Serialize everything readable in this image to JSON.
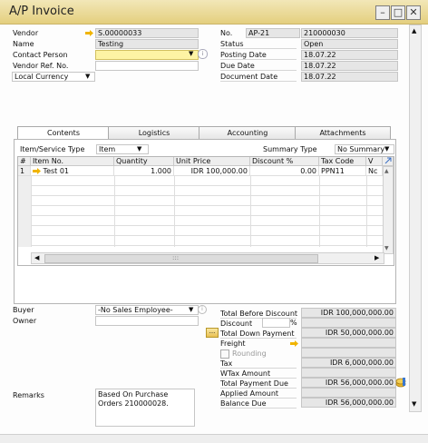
{
  "window": {
    "title": "A/P Invoice"
  },
  "header_left": {
    "vendor": {
      "label": "Vendor",
      "value": "S.00000033"
    },
    "name": {
      "label": "Name",
      "value": "Testing"
    },
    "contact_person": {
      "label": "Contact Person",
      "value": ""
    },
    "vendor_ref": {
      "label": "Vendor Ref. No.",
      "value": ""
    },
    "currency": {
      "value": "Local Currency"
    }
  },
  "header_right": {
    "no": {
      "label": "No.",
      "series": "AP-21",
      "value": "210000030"
    },
    "status": {
      "label": "Status",
      "value": "Open"
    },
    "posting_date": {
      "label": "Posting Date",
      "value": "18.07.22"
    },
    "due_date": {
      "label": "Due Date",
      "value": "18.07.22"
    },
    "document_date": {
      "label": "Document Date",
      "value": "18.07.22"
    }
  },
  "tabs": [
    "Contents",
    "Logistics",
    "Accounting",
    "Attachments"
  ],
  "contents": {
    "item_type_label": "Item/Service Type",
    "item_type_value": "Item",
    "summary_type_label": "Summary Type",
    "summary_type_value": "No Summary",
    "columns": [
      "#",
      "Item No.",
      "Quantity",
      "Unit Price",
      "Discount %",
      "Tax Code",
      "V"
    ],
    "rows": [
      {
        "num": "1",
        "item": "Test 01",
        "qty": "1.000",
        "price": "IDR 100,000.00",
        "discount": "0.00",
        "tax": "PPN11",
        "v": "Nc"
      }
    ],
    "hscroll_mid": ":::"
  },
  "footer_left": {
    "buyer": {
      "label": "Buyer",
      "value": "-No Sales Employee-"
    },
    "owner": {
      "label": "Owner",
      "value": ""
    },
    "remarks": {
      "label": "Remarks",
      "value": "Based On Purchase Orders 210000028."
    }
  },
  "totals": {
    "total_before_discount": {
      "label": "Total Before Discount",
      "value": "IDR 100,000,000.00"
    },
    "discount": {
      "label": "Discount",
      "pct_sign": "%",
      "value": ""
    },
    "dp_button": "...",
    "total_down_payment": {
      "label": "Total Down Payment",
      "value": "IDR 50,000,000.00"
    },
    "freight": {
      "label": "Freight",
      "value": ""
    },
    "rounding": {
      "label": "Rounding",
      "value": ""
    },
    "tax": {
      "label": "Tax",
      "value": "IDR 6,000,000.00"
    },
    "wtax": {
      "label": "WTax Amount",
      "value": ""
    },
    "total_payment_due": {
      "label": "Total Payment Due",
      "value": "IDR 56,000,000.00"
    },
    "applied_amount": {
      "label": "Applied Amount",
      "value": ""
    },
    "balance_due": {
      "label": "Balance Due",
      "value": "IDR 56,000,000.00"
    }
  },
  "colors": {
    "link_arrow": "#f0b400",
    "title_bar": "#e8d48a"
  }
}
